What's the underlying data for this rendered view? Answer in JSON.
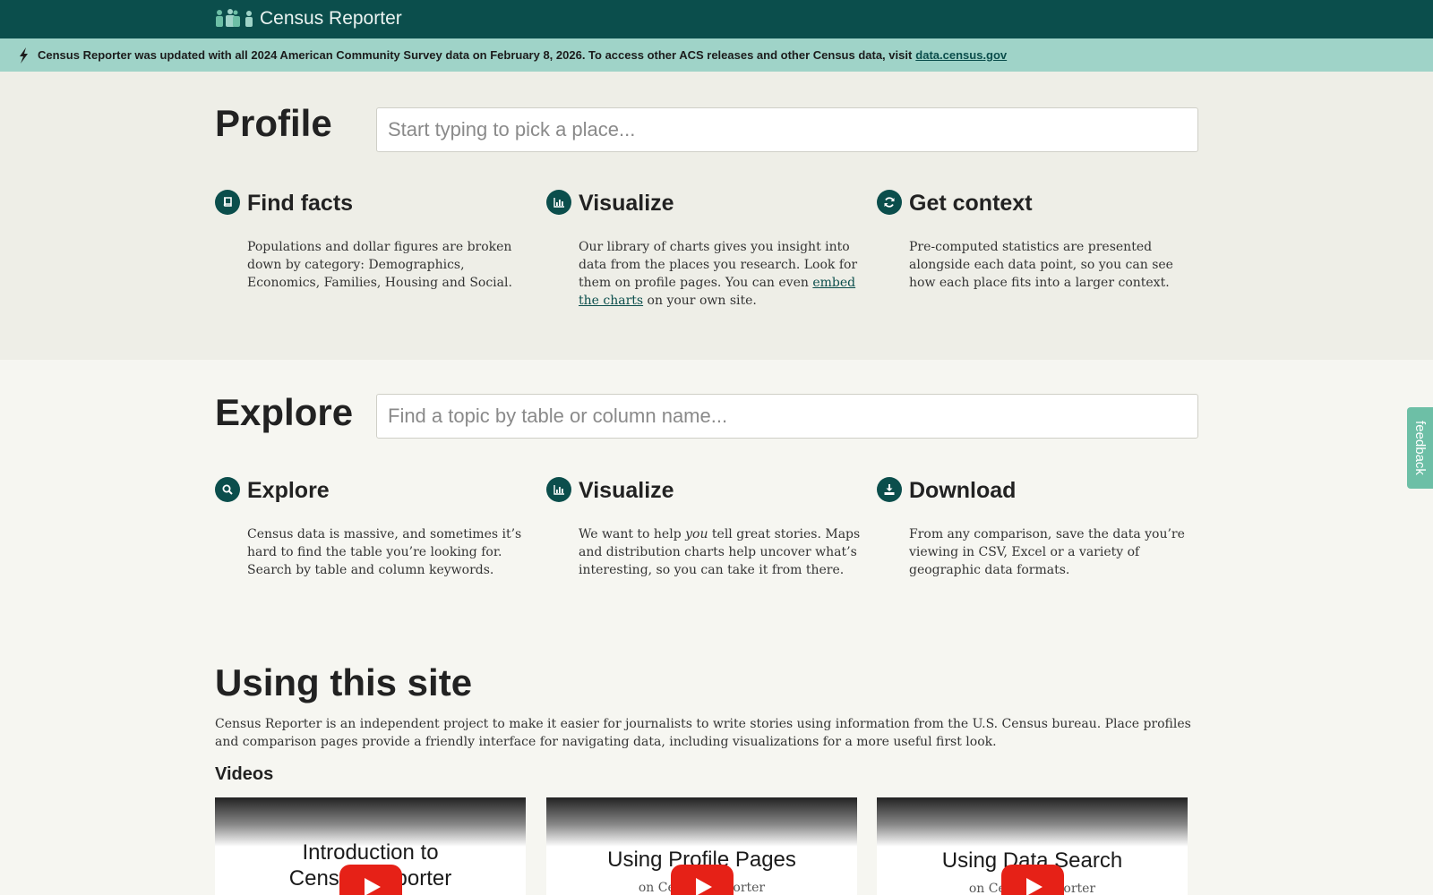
{
  "header": {
    "site_title": "Census Reporter"
  },
  "banner": {
    "message": "Census Reporter was updated with all 2024 American Community Survey data on February 8, 2026. To access other ACS releases and other Census data, visit",
    "link_text": "data.census.gov"
  },
  "profile": {
    "title": "Profile",
    "search_placeholder": "Start typing to pick a place...",
    "features": [
      {
        "icon": "book-icon",
        "heading": "Find facts",
        "text": "Populations and dollar figures are broken down by category: Demographics, Economics, Families, Housing and Social."
      },
      {
        "icon": "bar-chart-icon",
        "heading": "Visualize",
        "text_before": "Our library of charts gives you insight into data from the places you research. Look for them on profile pages. You can even",
        "link_text": "embed the charts",
        "text_after": "on your own site."
      },
      {
        "icon": "refresh-icon",
        "heading": "Get context",
        "text": "Pre-computed statistics are presented alongside each data point, so you can see how each place fits into a larger context."
      }
    ]
  },
  "explore": {
    "title": "Explore",
    "search_placeholder": "Find a topic by table or column name...",
    "features": [
      {
        "icon": "search-icon",
        "heading": "Explore",
        "text": "Census data is massive, and sometimes it’s hard to find the table you’re looking for. Search by table and column keywords."
      },
      {
        "icon": "bar-chart-icon",
        "heading": "Visualize",
        "text_before": "We want to help",
        "emphasis": "you",
        "text_after": "tell great stories. Maps and distribution charts help uncover what’s interesting, so you can take it from there."
      },
      {
        "icon": "download-icon",
        "heading": "Download",
        "text": "From any comparison, save the data you’re viewing in CSV, Excel or a variety of geographic data formats."
      }
    ]
  },
  "using": {
    "title": "Using this site",
    "description": "Census Reporter is an independent project to make it easier for journalists to write stories using information from the U.S. Census bureau. Place profiles and comparison pages provide a friendly interface for navigating data, including visualizations for a more useful first look.",
    "videos_heading": "Videos",
    "videos": [
      {
        "title_line1": "Introduction to",
        "title_line2": "Census Reporter"
      },
      {
        "title": "Using Profile Pages",
        "subtitle": "on Census Reporter"
      },
      {
        "title": "Using Data Search",
        "subtitle": "on Census Reporter"
      }
    ]
  },
  "feedback": {
    "label": "feedback"
  },
  "colors": {
    "header": "#0b4e4c",
    "banner": "#9fd3c8",
    "accent": "#0b4e4c",
    "feedback_tab": "#6dbfa6",
    "play_button": "#e62117"
  }
}
